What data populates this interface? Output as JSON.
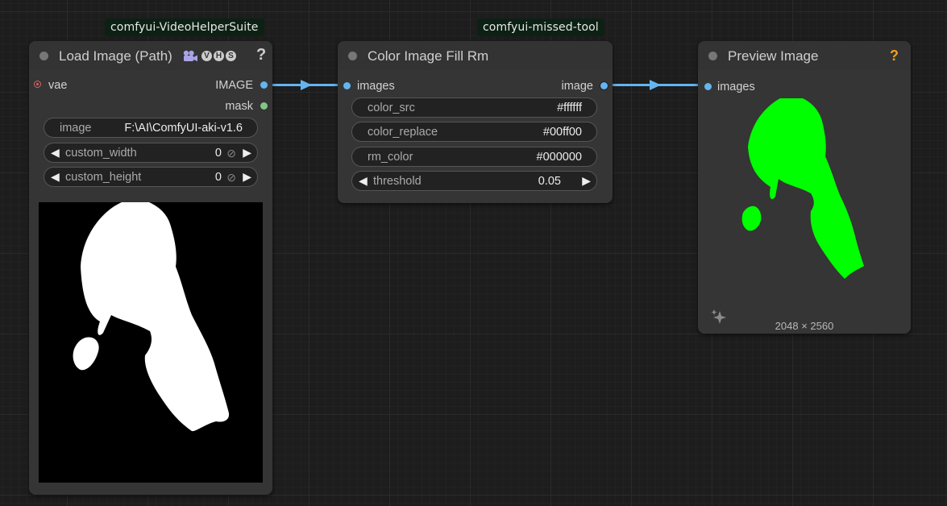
{
  "badges": {
    "vhs": "comfyui-VideoHelperSuite",
    "missed": "comfyui-missed-tool"
  },
  "load_node": {
    "title": "Load Image (Path)",
    "help": "?",
    "badge_icons": [
      "camera-icon",
      "V",
      "H",
      "S"
    ],
    "inputs": [
      {
        "label": "vae",
        "color": "#e06060"
      }
    ],
    "outputs": [
      {
        "label": "IMAGE",
        "color": "#64b4f0"
      },
      {
        "label": "mask",
        "color": "#81c784"
      }
    ],
    "widgets": {
      "image": {
        "name": "image",
        "value": "F:\\AI\\ComfyUI-aki-v1.6"
      },
      "custom_width": {
        "name": "custom_width",
        "value": "0"
      },
      "custom_height": {
        "name": "custom_height",
        "value": "0"
      }
    }
  },
  "fill_node": {
    "title": "Color Image Fill Rm",
    "inputs": [
      {
        "label": "images",
        "color": "#64b4f0"
      }
    ],
    "outputs": [
      {
        "label": "image",
        "color": "#64b4f0"
      }
    ],
    "widgets": {
      "color_src": {
        "name": "color_src",
        "value": "#ffffff"
      },
      "color_replace": {
        "name": "color_replace",
        "value": "#00ff00"
      },
      "rm_color": {
        "name": "rm_color",
        "value": "#000000"
      },
      "threshold": {
        "name": "threshold",
        "value": "0.05"
      }
    }
  },
  "preview_node": {
    "title": "Preview Image",
    "help": "?",
    "inputs": [
      {
        "label": "images",
        "color": "#64b4f0"
      }
    ],
    "image_size": "2048 × 2560",
    "fill_color": "#00ff00"
  },
  "colors": {
    "link": "#64b4f0",
    "help_orange": "#f0a020"
  }
}
